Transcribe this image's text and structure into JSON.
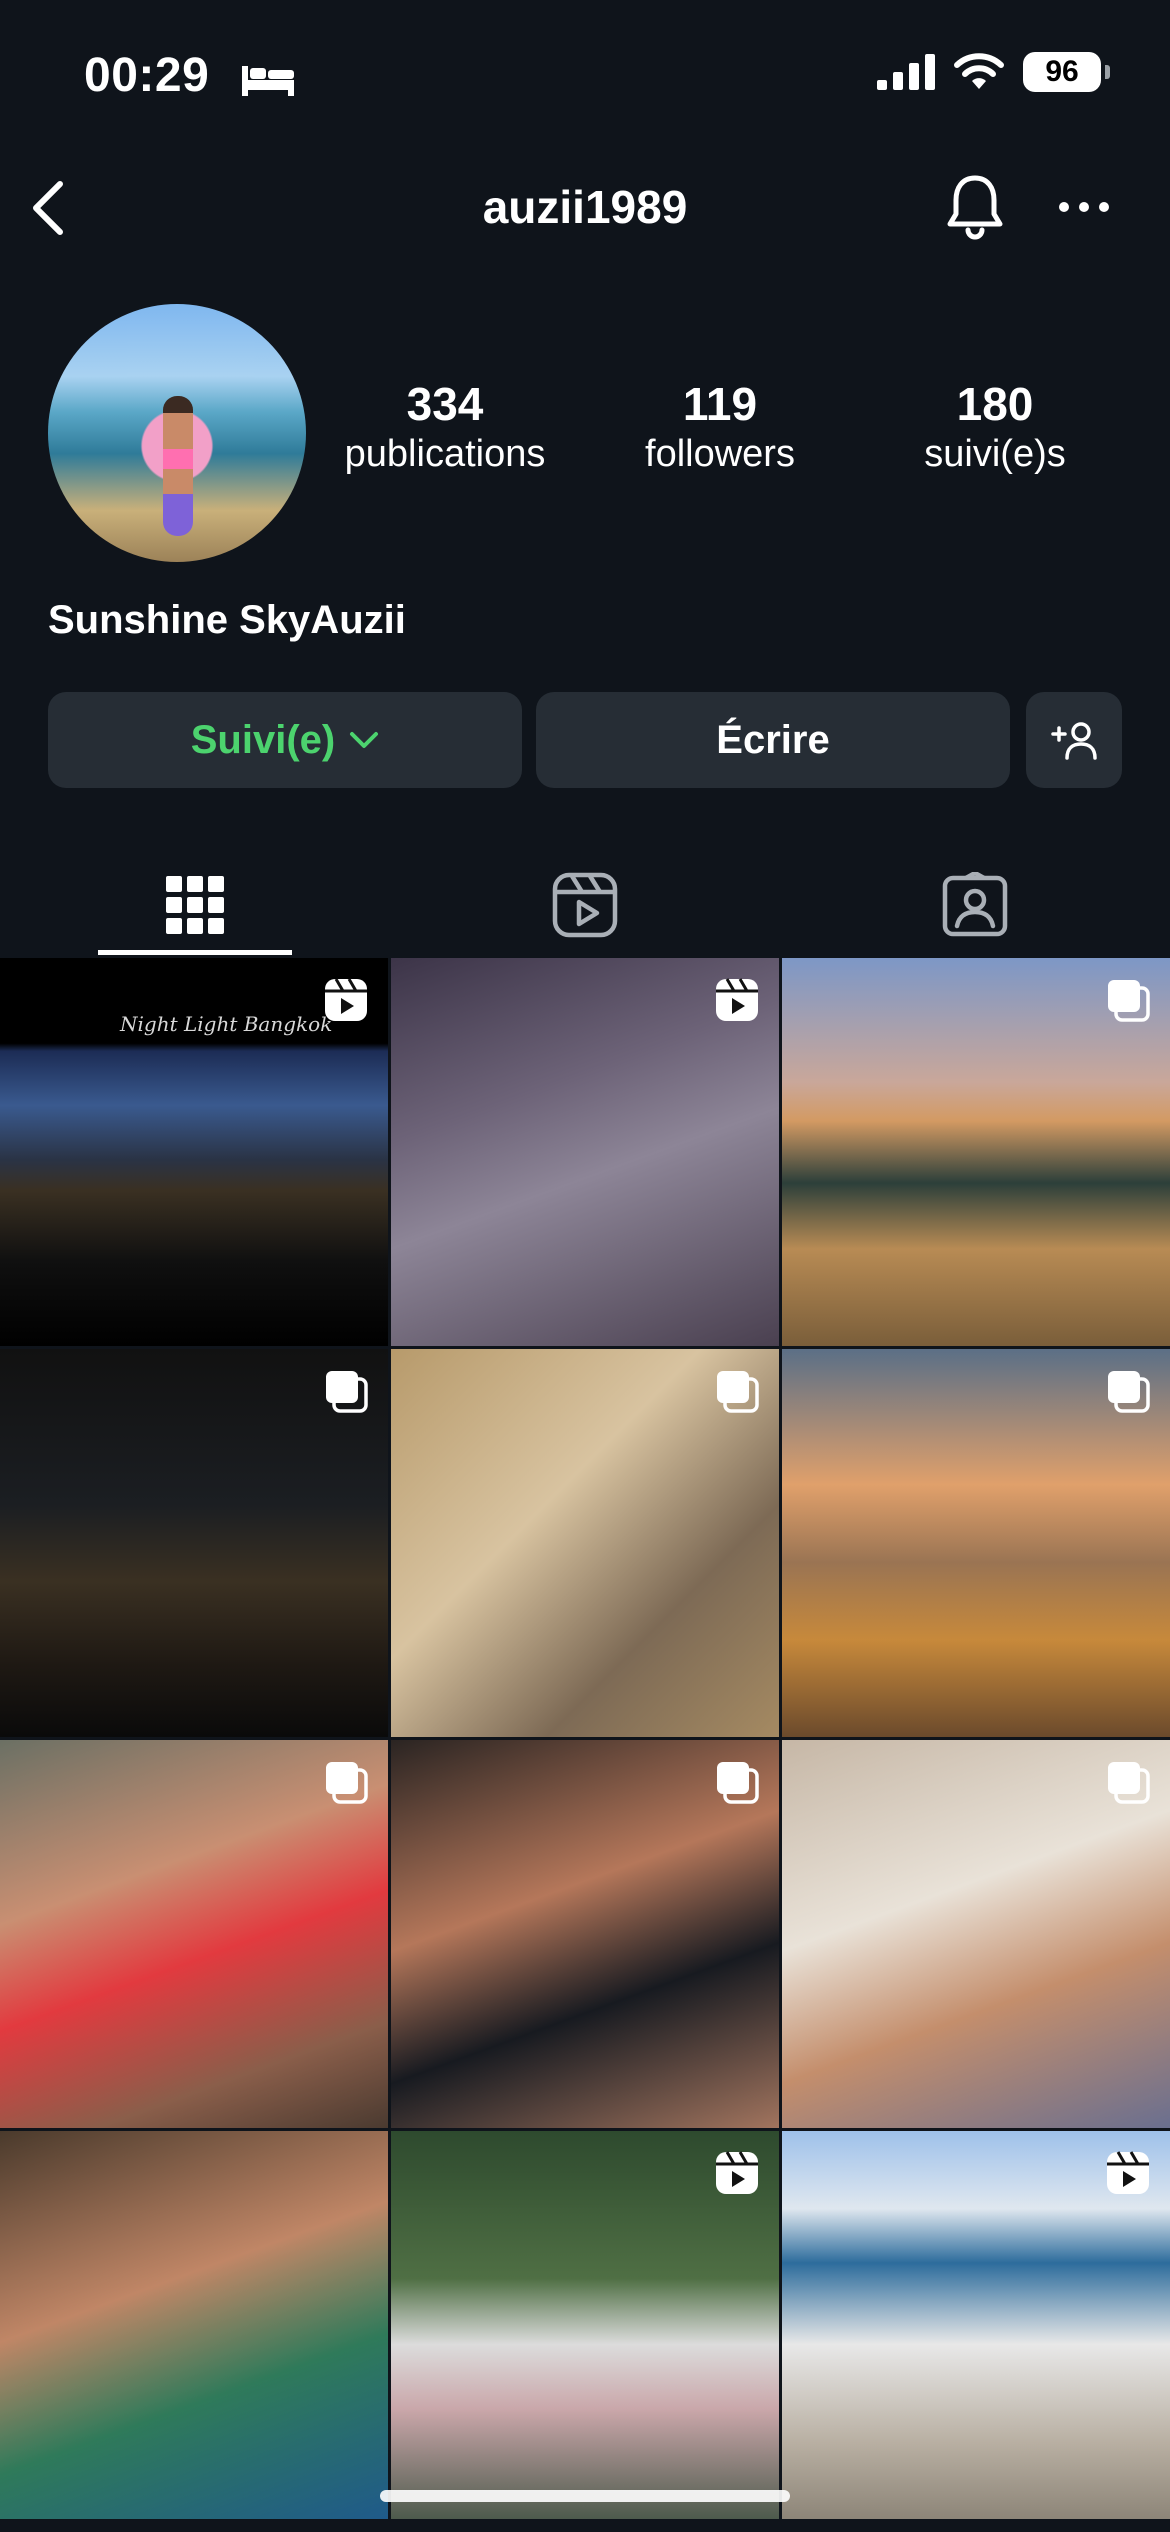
{
  "status_bar": {
    "time": "00:29",
    "battery": "96"
  },
  "header": {
    "username": "auzii1989"
  },
  "profile": {
    "stats": [
      {
        "value": "334",
        "label": "publications"
      },
      {
        "value": "119",
        "label": "followers"
      },
      {
        "value": "180",
        "label": "suivi(e)s"
      }
    ],
    "full_name": "Sunshine SkyAuzii"
  },
  "actions": {
    "follow_label": "Suivi(e)",
    "message_label": "Écrire"
  },
  "colors": {
    "background": "#0f141b",
    "button_bg": "#262d35",
    "follow_green": "#4cd36e"
  },
  "grid": {
    "tiles": [
      {
        "type": "reel",
        "overlay_text": "Night Light Bangkok"
      },
      {
        "type": "reel"
      },
      {
        "type": "carousel"
      },
      {
        "type": "carousel"
      },
      {
        "type": "carousel"
      },
      {
        "type": "carousel"
      },
      {
        "type": "carousel"
      },
      {
        "type": "carousel"
      },
      {
        "type": "carousel"
      },
      {
        "type": "carousel"
      },
      {
        "type": "reel"
      },
      {
        "type": "reel"
      }
    ]
  }
}
